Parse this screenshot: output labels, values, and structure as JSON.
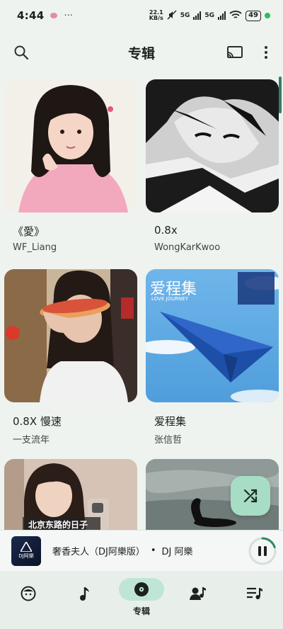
{
  "status_bar": {
    "time": "4:44",
    "dots": "···",
    "net_speed_top": "22.1",
    "net_speed_bottom": "KB/s",
    "net1": "5G",
    "net2": "5G",
    "battery": "49"
  },
  "header": {
    "title": "专辑",
    "search_icon": "search-icon",
    "cast_icon": "cast-icon",
    "more_icon": "more-vert-icon"
  },
  "albums": [
    {
      "title": "《愛》",
      "artist": "WF_Liang",
      "cover": "photo-girl-pink-shirt"
    },
    {
      "title": "0.8x",
      "artist": "WongKarKwoo",
      "cover": "bw-anime-boy"
    },
    {
      "title": "0.8X 慢速",
      "artist": "一支流年",
      "cover": "photo-girl-pizza"
    },
    {
      "title": "爱程集",
      "artist": "张信哲",
      "cover": "paper-plane-sky"
    },
    {
      "title": "",
      "artist": "",
      "cover": "photo-girl-mirror",
      "cover_text": "北京东路的日子"
    },
    {
      "title": "",
      "artist": "",
      "cover": "black-swan-water"
    }
  ],
  "album4_cover_text": "爱程集",
  "album4_cover_subtext": "LOVE JOURNEY",
  "fab": {
    "icon": "shuffle-icon"
  },
  "player": {
    "thumb_text": "DJ阿樂",
    "track": "奢香夫人（DJ阿樂版）",
    "separator": "•",
    "artist": "DJ 阿樂",
    "state_icon": "pause-icon",
    "progress": 0.2
  },
  "nav": [
    {
      "label": "",
      "icon": "face-icon"
    },
    {
      "label": "",
      "icon": "music-note-icon"
    },
    {
      "label": "专辑",
      "icon": "album-icon",
      "active": true
    },
    {
      "label": "",
      "icon": "artist-icon"
    },
    {
      "label": "",
      "icon": "playlist-icon"
    }
  ],
  "colors": {
    "accent": "#3a7a62",
    "fab_bg": "#a7ddc4",
    "nav_active": "#bfe6d4"
  }
}
